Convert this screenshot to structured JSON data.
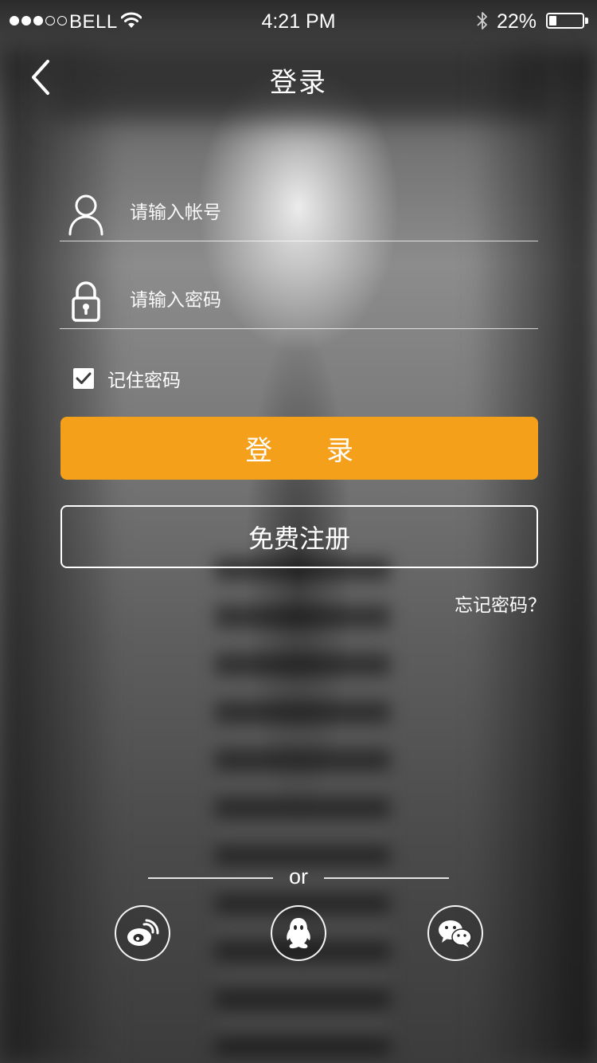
{
  "status_bar": {
    "signal_filled": 3,
    "signal_total": 5,
    "carrier": "BELL",
    "time": "4:21 PM",
    "battery_percent": "22%",
    "battery_level": 0.22,
    "icons": [
      "wifi-icon",
      "bluetooth-icon",
      "battery-icon"
    ]
  },
  "nav": {
    "title": "登录",
    "back_icon": "chevron-left-icon"
  },
  "form": {
    "username": {
      "icon": "user-icon",
      "placeholder": "请输入帐号",
      "value": ""
    },
    "password": {
      "icon": "lock-icon",
      "placeholder": "请输入密码",
      "value": ""
    },
    "remember": {
      "label": "记住密码",
      "checked": true
    },
    "login_label": "登　　录",
    "register_label": "免费注册",
    "forgot_label": "忘记密码？"
  },
  "social": {
    "divider_text": "or",
    "providers": [
      {
        "name": "weibo",
        "icon": "weibo-icon"
      },
      {
        "name": "qq",
        "icon": "qq-icon"
      },
      {
        "name": "wechat",
        "icon": "wechat-icon"
      }
    ]
  },
  "colors": {
    "accent": "#f5a01a",
    "text": "#ffffff"
  }
}
